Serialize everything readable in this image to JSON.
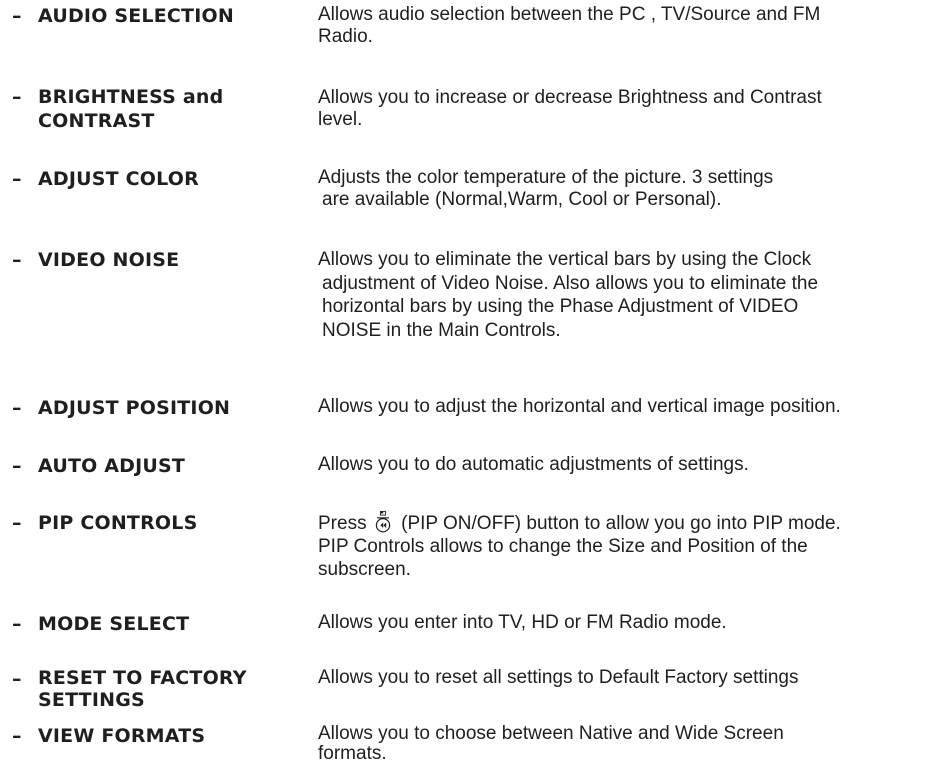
{
  "dash": "–",
  "entries": [
    {
      "term_lines": [
        "AUDIO SELECTION"
      ],
      "desc_lines": [
        "Allows audio selection between the PC , TV/Source and FM",
        "Radio."
      ]
    },
    {
      "term_lines": [
        "BRIGHTNESS and",
        "CONTRAST"
      ],
      "desc_lines": [
        "Allows you to increase or decrease Brightness and Contrast",
        "level."
      ]
    },
    {
      "term_lines": [
        "ADJUST COLOR"
      ],
      "desc_lines": [
        "Adjusts the color temperature of the picture. 3 settings",
        "are available (Normal,Warm, Cool or Personal)."
      ]
    },
    {
      "term_lines": [
        "VIDEO NOISE"
      ],
      "desc_lines": [
        "Allows you to eliminate the vertical bars by using the Clock",
        "adjustment of Video Noise. Also allows you to eliminate the",
        "horizontal bars by using the Phase Adjustment of  VIDEO",
        "NOISE in the Main Controls."
      ]
    },
    {
      "term_lines": [
        "ADJUST POSITION"
      ],
      "desc_lines": [
        "Allows you to adjust the horizontal and vertical image position."
      ]
    },
    {
      "term_lines": [
        "AUTO ADJUST"
      ],
      "desc_lines": [
        "Allows you to do automatic adjustments of settings."
      ]
    },
    {
      "term_lines": [
        "PIP CONTROLS"
      ],
      "desc_first_prefix": "Press",
      "desc_first_suffix": "(PIP ON/OFF) button to allow you go into PIP mode.",
      "desc_lines": [
        "PIP Controls allows to change the Size and Position of the",
        "subscreen."
      ]
    },
    {
      "term_lines": [
        "MODE SELECT"
      ],
      "desc_lines": [
        "Allows you enter into TV, HD or FM Radio mode."
      ]
    },
    {
      "term_lines": [
        "RESET TO FACTORY",
        "SETTINGS"
      ],
      "desc_lines": [
        "Allows you to reset all settings to Default Factory settings"
      ]
    },
    {
      "term_lines": [
        "VIEW FORMATS"
      ],
      "desc_lines": [
        "Allows you to choose between Native and Wide Screen",
        "formats."
      ]
    }
  ],
  "icons": {
    "pip_button": "pip-button-icon"
  }
}
